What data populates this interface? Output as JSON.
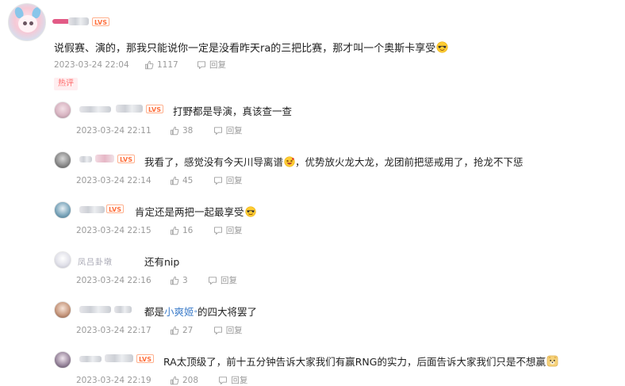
{
  "main_comment": {
    "badge": "LVS",
    "text": "说假赛、演的，那我只能说你一定是没看昨天ra的三把比赛，那才叫一个奥斯卡享受",
    "time": "2023-03-24 22:04",
    "likes": "1117",
    "reply_label": "回复"
  },
  "hot_tag": "热评",
  "replies": [
    {
      "badge": "LVS",
      "text": "打野都是导演，真该查一查",
      "time": "2023-03-24 22:11",
      "likes": "38",
      "reply_label": "回复"
    },
    {
      "badge": "LVS",
      "text_a": "我看了，感觉没有今天川导离谱",
      "text_b": "，优势放火龙大龙，龙团前把惩戒用了，抢龙不下惩",
      "time": "2023-03-24 22:14",
      "likes": "45",
      "reply_label": "回复"
    },
    {
      "badge": "LVS",
      "text": "肯定还是两把一起最享受",
      "time": "2023-03-24 22:15",
      "likes": "16",
      "reply_label": "回复"
    },
    {
      "name": "凤吕卦墩",
      "text": "还有nip",
      "time": "2023-03-24 22:16",
      "likes": "3",
      "reply_label": "回复"
    },
    {
      "text_a": "都是",
      "highlight": "小爽姬",
      "text_b": "的四大将罢了",
      "time": "2023-03-24 22:17",
      "likes": "27",
      "reply_label": "回复"
    },
    {
      "badge": "LVS",
      "text": "RA太顶级了，前十五分钟告诉大家我们有赢RNG的实力，后面告诉大家我们只是不想赢",
      "time": "2023-03-24 22:19",
      "likes": "208",
      "reply_label": "回复"
    }
  ],
  "icons": [
    "thumb-up-icon",
    "reply-icon",
    "sunglasses-emoji-icon",
    "laugh-emoji-icon",
    "doge-emoji-icon"
  ],
  "colors": {
    "badge": "#ff6f3c",
    "hot_tag": "#ff6a6a",
    "highlight_link": "#3c7cc9",
    "meta": "#9a9a9a"
  }
}
